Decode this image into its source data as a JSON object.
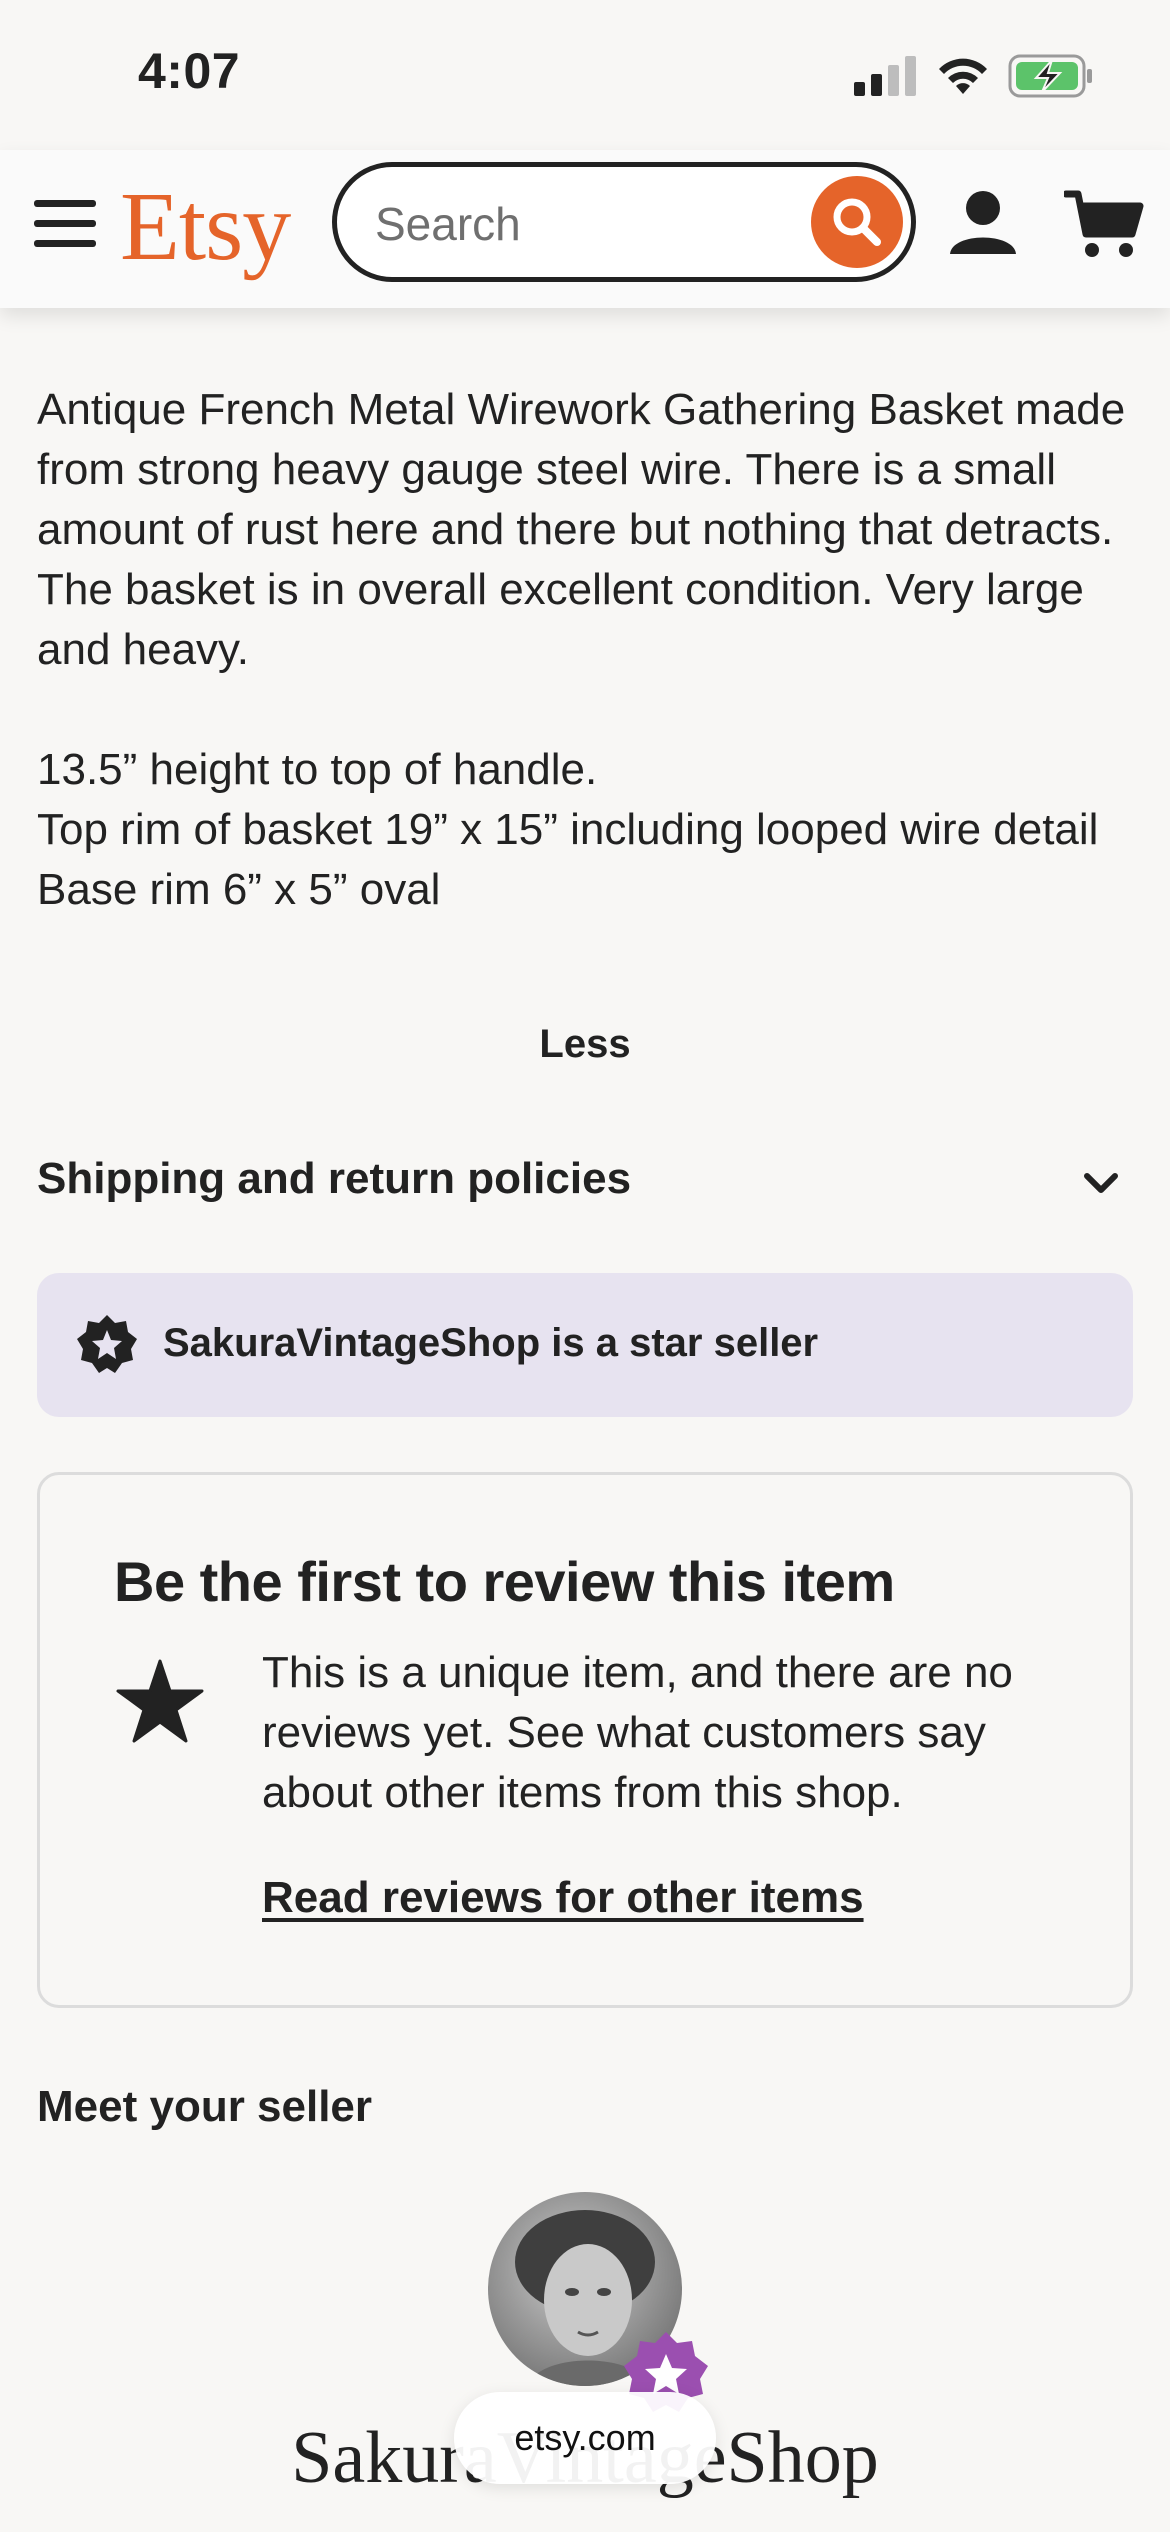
{
  "status_bar": {
    "time": "4:07"
  },
  "header": {
    "logo": "Etsy",
    "search_placeholder": "Search"
  },
  "description": {
    "paragraph": "Antique French Metal Wirework Gathering Basket made from strong heavy gauge steel wire. There is a small amount of rust here and there but nothing that detracts. The basket is in overall excellent condition. Very large and heavy.",
    "line1": "13.5” height to top of handle.",
    "line2": "Top rim of basket 19” x 15” including looped wire detail",
    "line3": "Base rim 6” x 5” oval",
    "less_label": "Less"
  },
  "shipping": {
    "label": "Shipping and return policies"
  },
  "star_seller": {
    "text": "SakuraVintageShop is a star seller"
  },
  "review": {
    "title": "Be the first to review this item",
    "body": "This is a unique item, and there are no reviews yet. See what customers say about other items from this shop.",
    "link": "Read reviews for other items"
  },
  "seller": {
    "heading": "Meet your seller",
    "shop_name": "SakuraVintageShop"
  },
  "browser": {
    "url": "etsy.com"
  },
  "colors": {
    "brand": "#e5642a",
    "star_seller_bg": "#e7e3f0",
    "badge": "#9b4fb0"
  }
}
